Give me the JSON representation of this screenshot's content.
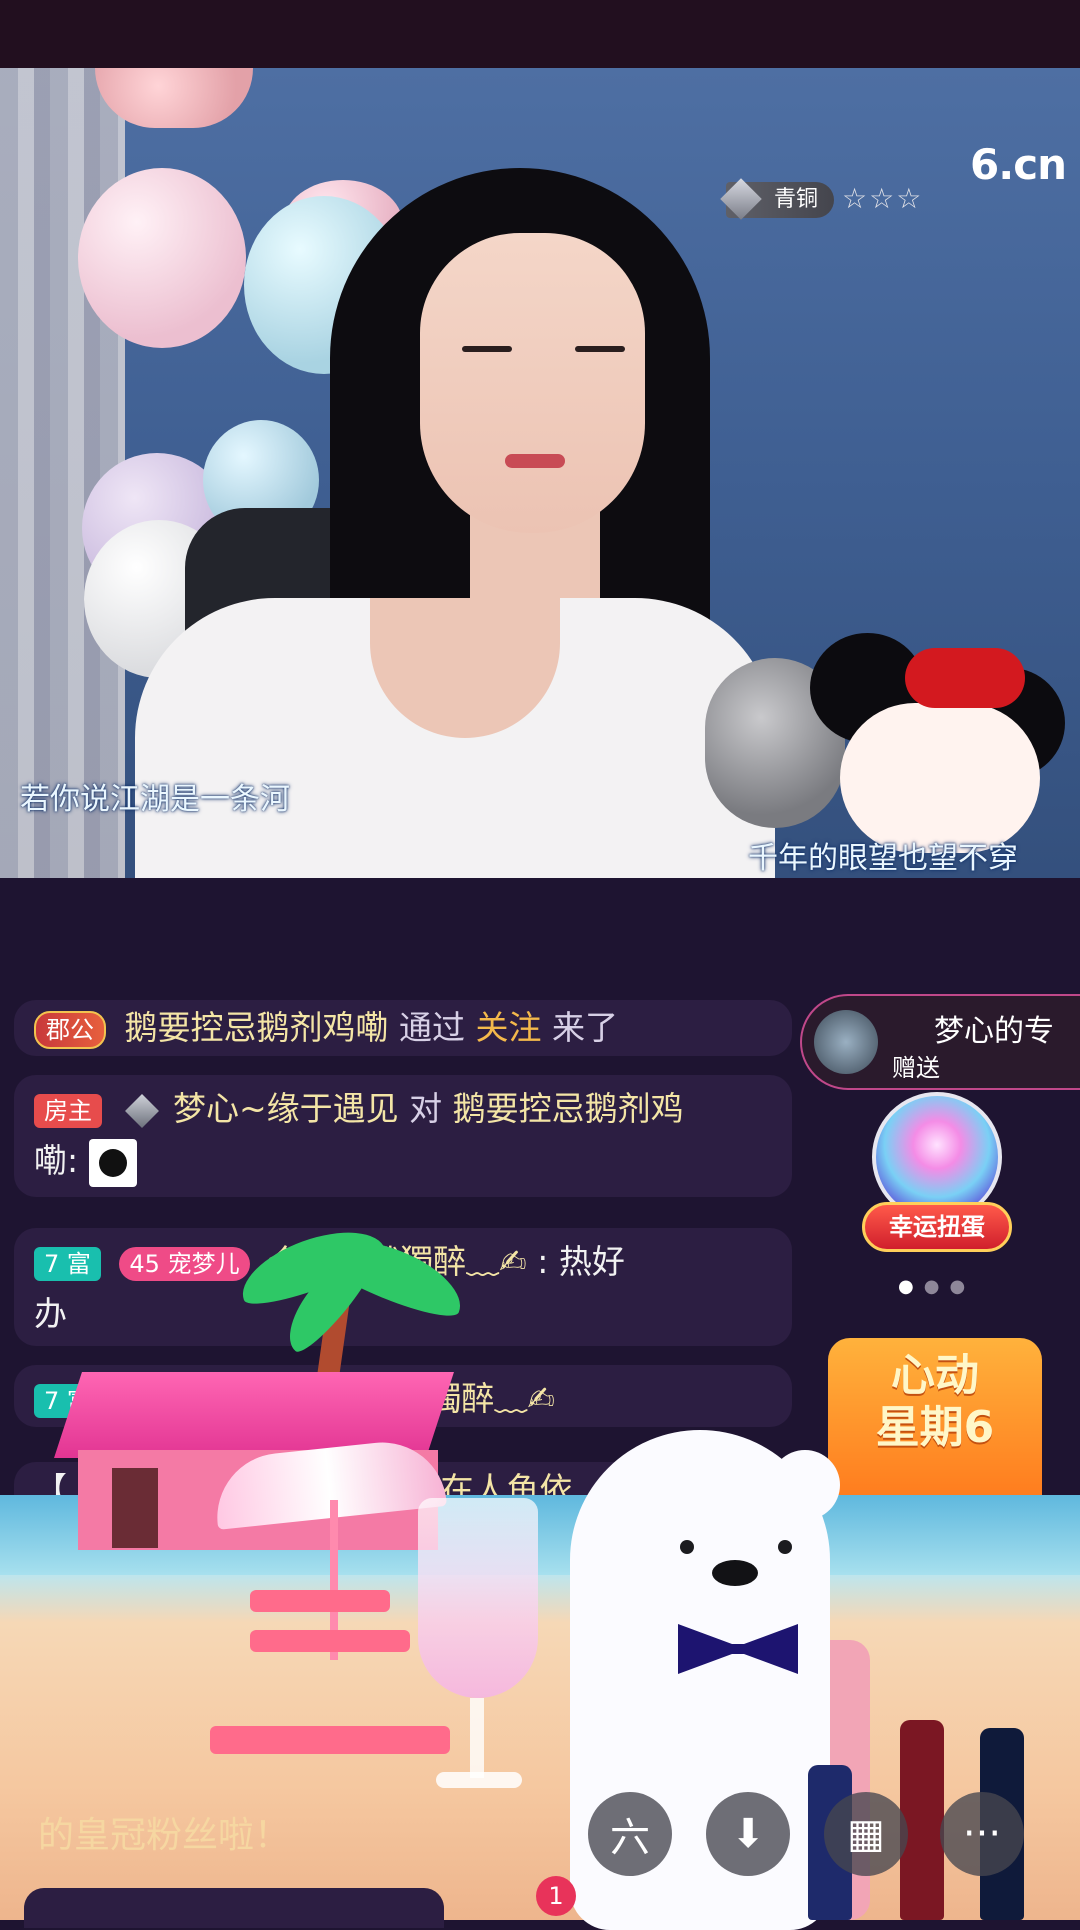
{
  "video": {
    "logo": "6.cn",
    "level": "青铜",
    "stars": "☆☆☆",
    "lyric_left": "若你说江湖是一条河",
    "lyric_right": "千年的眼望也望不穿"
  },
  "chat": {
    "msg1": {
      "badge": "郡公",
      "name": "鹅要控忌鹅剂鸡嘞",
      "via": "通过",
      "action": "关注",
      "suffix": "来了"
    },
    "msg2": {
      "badge": "房主",
      "name": "梦心~缘于遇见",
      "to": "对",
      "target": "鹅要控忌鹅剂鸡",
      "target2": "嘞:"
    },
    "msg3": {
      "badge_level": "7 富",
      "fan_num": "45",
      "fan_name": "宠梦儿",
      "name": "个啫醒涐獨醉﹏✍",
      "text": ": 热好",
      "text2": "办"
    },
    "msg4": {
      "badge_level": "7 富",
      "name": "啫醒涐獨醉﹏✍"
    },
    "msg5": {
      "prefix": "【",
      "text": "正在人鱼依"
    },
    "fans_text": "的皇冠粉丝啦！"
  },
  "gift": {
    "title": "梦心的专",
    "sub": "赠送"
  },
  "lucky": {
    "label": "幸运扭蛋"
  },
  "carousel": {
    "dots": "● ● ●"
  },
  "promo": {
    "line1": "心动",
    "line2": "星期6"
  },
  "actions": {
    "six_icon": "六",
    "download_icon": "⬇",
    "grid_icon": "▦",
    "more_icon": "···",
    "badge_count": "1"
  }
}
